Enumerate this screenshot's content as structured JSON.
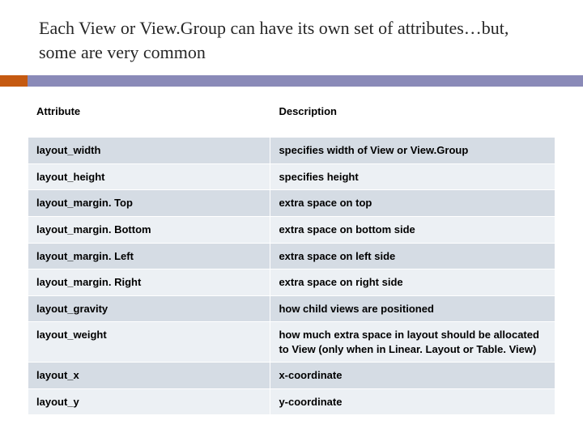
{
  "title": "Each View or View.Group can have its own set of attributes…but, some are very common",
  "headers": {
    "attribute": "Attribute",
    "description": "Description"
  },
  "rows": [
    {
      "attr": "layout_width",
      "desc": "specifies width of View or View.Group"
    },
    {
      "attr": "layout_height",
      "desc": "specifies height"
    },
    {
      "attr": "layout_margin. Top",
      "desc": "extra space on top"
    },
    {
      "attr": "layout_margin. Bottom",
      "desc": "extra space on bottom side"
    },
    {
      "attr": "layout_margin. Left",
      "desc": "extra space on left side"
    },
    {
      "attr": "layout_margin. Right",
      "desc": "extra space on right side"
    },
    {
      "attr": "layout_gravity",
      "desc": "how child views are positioned"
    },
    {
      "attr": "layout_weight",
      "desc": "how much extra space in layout should be allocated to View (only when in Linear. Layout or Table. View)"
    },
    {
      "attr": "layout_x",
      "desc": "x-coordinate"
    },
    {
      "attr": "layout_y",
      "desc": "y-coordinate"
    }
  ]
}
